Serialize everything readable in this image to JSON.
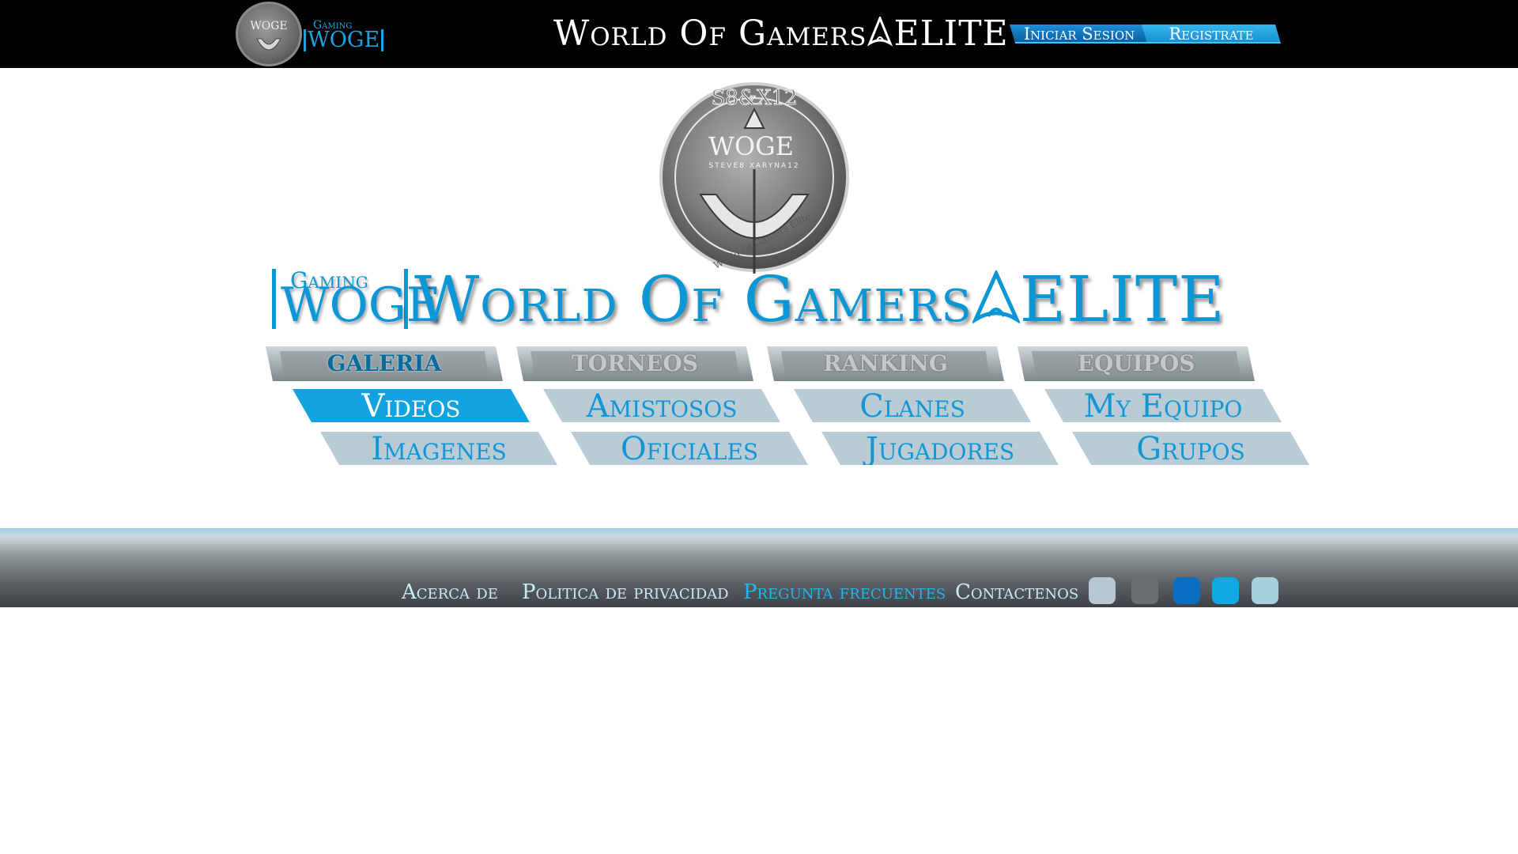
{
  "header": {
    "logo": {
      "emblem_text": "WOGE",
      "gaming": "Gaming",
      "wordmark": "WOGE"
    },
    "title": "World Of Gamers",
    "title_suffix": "ELITE",
    "login_label": "Iniciar Sesion",
    "register_label": "Registrate"
  },
  "hero": {
    "emblem": {
      "top_text": "S8&X12",
      "center_text": "WOGE",
      "sub_text": "STEVE8 XARYNA12",
      "ring_text": "World Of Gamers Elite"
    },
    "banner": {
      "gaming": "Gaming",
      "wordmark": "WOGE",
      "title": "World Of Gamers",
      "suffix": "ELITE"
    }
  },
  "menu": {
    "categories": [
      {
        "label": "GALERIA",
        "items": [
          "Videos",
          "Imagenes"
        ]
      },
      {
        "label": "TORNEOS",
        "items": [
          "Amistosos",
          "Oficiales"
        ]
      },
      {
        "label": "RANKING",
        "items": [
          "Clanes",
          "Jugadores"
        ]
      },
      {
        "label": "EQUIPOS",
        "items": [
          "My Equipo",
          "Grupos"
        ]
      }
    ],
    "active_category": "GALERIA",
    "active_item": "Videos"
  },
  "footer": {
    "links": [
      "Acerca de",
      "Politica de privacidad",
      "Pregunta frecuentes",
      "Contactenos"
    ],
    "highlighted_link": "Pregunta frecuentes",
    "social_colors": [
      "#b8c8d2",
      "#6c6f72",
      "#0a6fc2",
      "#11a8e6",
      "#a6d0da"
    ]
  },
  "colors": {
    "accent": "#0b96d6",
    "top_bar": "#000000",
    "active_item": "#11a2e0",
    "inactive_item": "#b9ccd6"
  }
}
